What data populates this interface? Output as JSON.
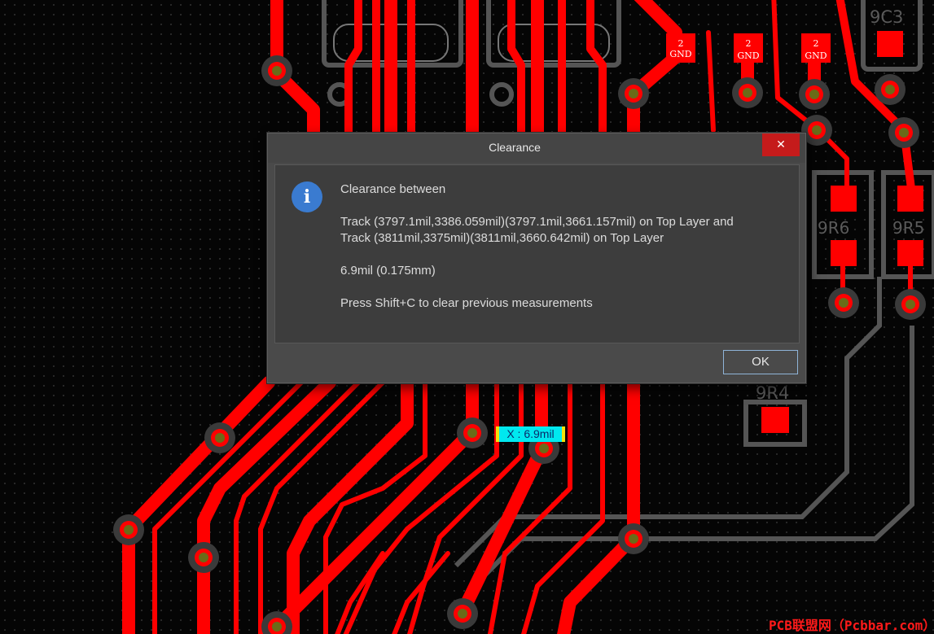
{
  "dialog": {
    "title": "Clearance",
    "close_symbol": "✕",
    "icon": "info-icon",
    "icon_glyph": "i",
    "line_heading": "Clearance between",
    "line_track1": "Track (3797.1mil,3386.059mil)(3797.1mil,3661.157mil) on Top Layer and",
    "line_track2": "Track (3811mil,3375mil)(3811mil,3660.642mil) on Top Layer",
    "line_value": "6.9mil (0.175mm)",
    "line_hint": "Press Shift+C to clear previous measurements",
    "ok_label": "OK"
  },
  "pcb": {
    "measurement_label": "X : 6.9mil",
    "component_labels": {
      "c3": "9C3",
      "r4": "9R4",
      "r_left": "9R6",
      "r_right": "9R5",
      "pad_net_num": "2",
      "pad_net_name": "GND"
    },
    "colors": {
      "track": "#ff0000",
      "background": "#050505",
      "silkscreen": "#5a5a5a",
      "via_ring": "#3a3a3a",
      "via_hole": "#6b6b18"
    }
  },
  "watermark": "PCB联盟网（Pcbbar.com）"
}
